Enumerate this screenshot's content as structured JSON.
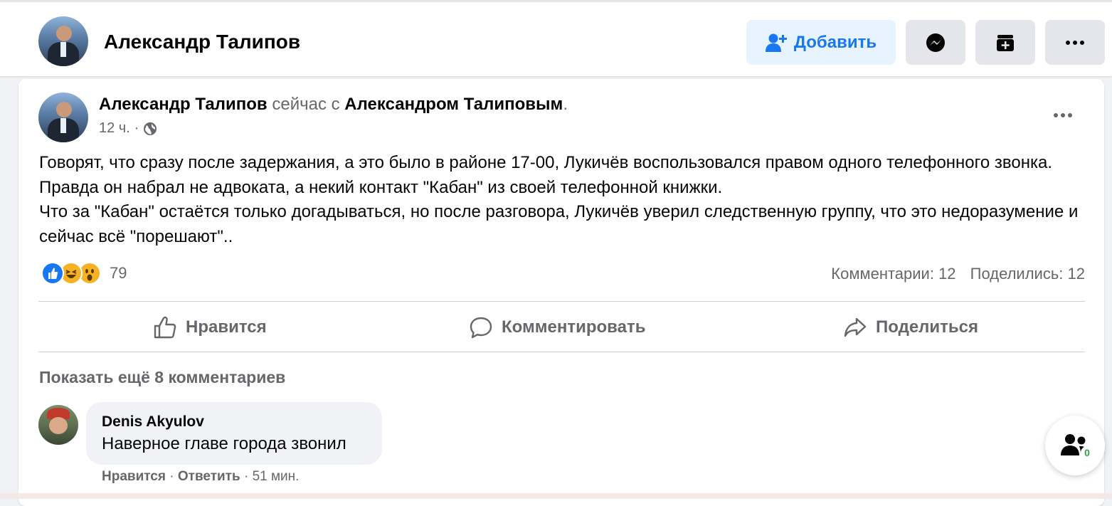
{
  "header": {
    "name": "Александр Талипов",
    "add_label": "Добавить"
  },
  "post": {
    "author": "Александр Талипов",
    "middle": " сейчас с ",
    "with": "Александром Талиповым",
    "end": ".",
    "time": "12 ч.",
    "paragraphs": [
      "Говорят, что сразу после задержания, а это было в районе 17-00, Лукичёв воспользовался правом одного телефонного звонка. Правда он набрал не адвоката, а некий контакт \"Кабан\" из своей телефонной книжки.",
      "Что за \"Кабан\" остаётся только догадываться, но после разговора, Лукичёв уверил следственную группу, что это недоразумение и сейчас всё \"порешают\".."
    ],
    "reactions_count": "79",
    "comments_count": "Комментарии: 12",
    "shares_count": "Поделились: 12"
  },
  "actions": {
    "like": "Нравится",
    "comment": "Комментировать",
    "share": "Поделиться"
  },
  "comments": {
    "show_more": "Показать ещё 8 комментариев",
    "items": [
      {
        "author": "Denis Akyulov",
        "text": "Наверное главе города звонил",
        "like": "Нравится",
        "sep": " · ",
        "reply": "Ответить",
        "time": "51 мин."
      }
    ]
  },
  "chat": {
    "badge": "0"
  },
  "colors": {
    "accent": "#1877f2",
    "secondary_text": "#65676b",
    "background": "#f0f2f5"
  }
}
